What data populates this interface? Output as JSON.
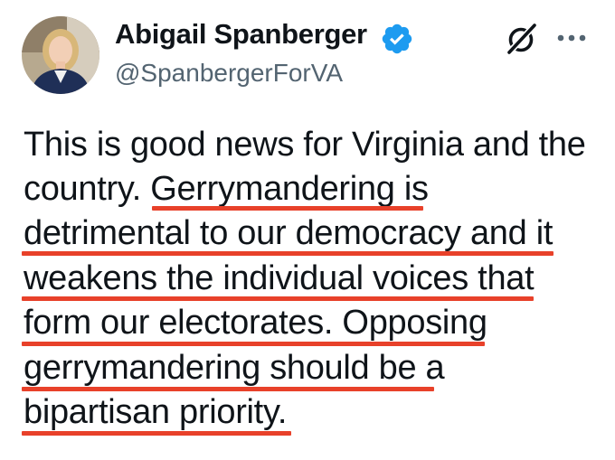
{
  "author": {
    "display_name": "Abigail Spanberger",
    "handle": "@SpanbergerForVA",
    "verified": true,
    "verified_color": "#1d9bf0"
  },
  "actions": {
    "grok_icon": "grok-icon",
    "more_icon": "more-options-icon"
  },
  "tweet": {
    "lines": [
      "This is good news for Virginia and the",
      "country. Gerrymandering is",
      "detrimental to our democracy and it",
      "weakens the individual voices that",
      "form our electorates. Opposing",
      "gerrymandering should be a",
      "bipartisan priority."
    ]
  },
  "colors": {
    "underline": "#e8412a",
    "text": "#0f1419",
    "handle": "#536471"
  }
}
